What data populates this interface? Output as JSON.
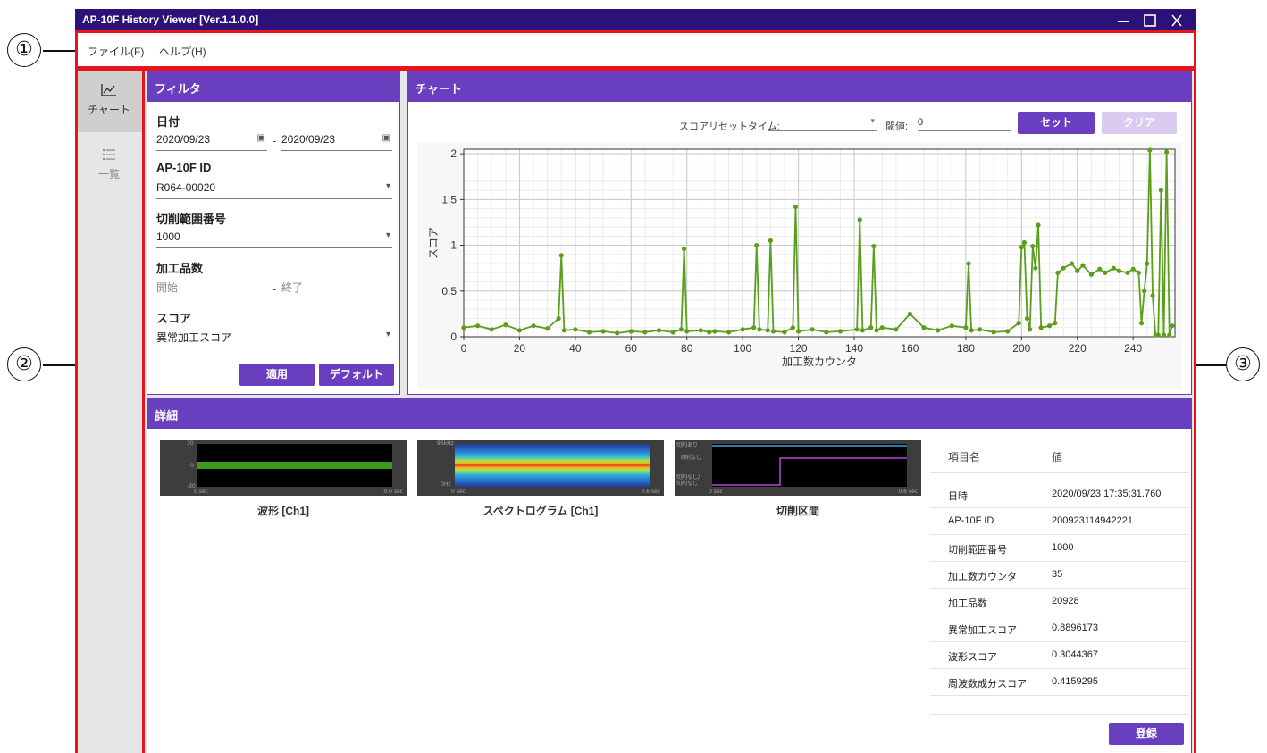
{
  "callouts": {
    "c1": "①",
    "c2": "②",
    "c3": "③"
  },
  "window": {
    "title": "AP-10F History Viewer [Ver.1.1.0.0]"
  },
  "menu": [
    {
      "label": "ファイル(F)"
    },
    {
      "label": "ヘルプ(H)"
    }
  ],
  "nav": [
    {
      "label": "チャート",
      "icon": "chart-line-icon",
      "active": true
    },
    {
      "label": "一覧",
      "icon": "list-icon",
      "active": false
    }
  ],
  "filter": {
    "header": "フィルタ",
    "date_label": "日付",
    "date_from": "2020/09/23",
    "date_to": "2020/09/23",
    "date_sep": "-",
    "id_label": "AP-10F ID",
    "id_value": "R064-00020",
    "range_label": "切削範囲番号",
    "range_value": "1000",
    "count_label": "加工品数",
    "count_start_placeholder": "開始",
    "count_end_placeholder": "終了",
    "count_sep": "-",
    "score_label": "スコア",
    "score_value": "異常加工スコア",
    "apply_button": "適用",
    "default_button": "デフォルト"
  },
  "chart_panel": {
    "header": "チャート",
    "reset_label": "スコアリセットタイム:",
    "reset_value": "",
    "threshold_label": "閾値:",
    "threshold_value": "0",
    "set_button": "セット",
    "clear_button": "クリア"
  },
  "chart_data": {
    "type": "line",
    "xlabel": "加工数カウンタ",
    "ylabel": "スコア",
    "xlim": [
      0,
      255
    ],
    "ylim": [
      0,
      2.05
    ],
    "xticks": [
      0,
      20,
      40,
      60,
      80,
      100,
      120,
      140,
      160,
      180,
      200,
      220,
      240
    ],
    "yticks": [
      0,
      0.5,
      1,
      1.5,
      2
    ],
    "ytick_labels": [
      "0",
      "0.5",
      "1",
      "1.5",
      "2"
    ],
    "grid": true,
    "color": "#5a9e1b",
    "x": [
      0,
      5,
      10,
      15,
      20,
      25,
      30,
      34,
      35,
      36,
      40,
      45,
      50,
      55,
      60,
      65,
      70,
      75,
      78,
      79,
      80,
      85,
      88,
      90,
      95,
      100,
      104,
      105,
      106,
      109,
      110,
      111,
      115,
      118,
      119,
      120,
      125,
      130,
      135,
      141,
      142,
      143,
      146,
      147,
      148,
      150,
      155,
      160,
      165,
      170,
      175,
      180,
      181,
      182,
      185,
      190,
      195,
      199,
      200,
      201,
      202,
      203,
      204,
      205,
      206,
      207,
      210,
      212,
      213,
      215,
      218,
      220,
      222,
      225,
      228,
      230,
      233,
      235,
      238,
      240,
      242,
      243,
      244,
      245,
      246,
      247,
      248,
      249,
      250,
      251,
      252,
      253,
      254
    ],
    "y": [
      0.1,
      0.12,
      0.08,
      0.13,
      0.07,
      0.12,
      0.09,
      0.2,
      0.89,
      0.07,
      0.08,
      0.05,
      0.06,
      0.04,
      0.06,
      0.05,
      0.07,
      0.05,
      0.08,
      0.96,
      0.06,
      0.07,
      0.05,
      0.06,
      0.05,
      0.08,
      0.1,
      1.0,
      0.08,
      0.07,
      1.05,
      0.06,
      0.05,
      0.1,
      1.42,
      0.06,
      0.08,
      0.05,
      0.06,
      0.08,
      1.28,
      0.07,
      0.1,
      0.99,
      0.07,
      0.1,
      0.08,
      0.25,
      0.1,
      0.07,
      0.12,
      0.1,
      0.8,
      0.07,
      0.08,
      0.05,
      0.06,
      0.15,
      0.98,
      1.03,
      0.2,
      0.08,
      0.99,
      0.75,
      1.22,
      0.1,
      0.12,
      0.15,
      0.7,
      0.75,
      0.8,
      0.72,
      0.78,
      0.68,
      0.74,
      0.7,
      0.75,
      0.72,
      0.7,
      0.74,
      0.7,
      0.15,
      0.5,
      0.8,
      2.04,
      0.45,
      0.02,
      0.02,
      1.6,
      0.02,
      2.02,
      0.02,
      0.12
    ]
  },
  "detail": {
    "header": "詳細",
    "thumbs": [
      {
        "caption": "波形 [Ch1]",
        "ytop": "30",
        "ymid": "0",
        "ybot": "-30",
        "xleft": "0 sec",
        "xright": "0.6 sec"
      },
      {
        "caption": "スペクトログラム [Ch1]",
        "ytop": "96kHz",
        "ybot": "0Hz",
        "xleft": "0 sec",
        "xright": "0.6 sec"
      },
      {
        "caption": "切削区間",
        "ytop": "切削あり",
        "ymid": "切削なし",
        "ybot": "切削なし/",
        "ybot2": "切削なし",
        "xleft": "0 sec",
        "xright": "0.6 sec"
      }
    ],
    "props_header": {
      "key": "項目名",
      "value": "値"
    },
    "props": [
      {
        "key": "日時",
        "value": "2020/09/23 17:35:31.760"
      },
      {
        "key": "AP-10F ID",
        "value": "200923114942221"
      },
      {
        "key": "切削範囲番号",
        "value": "1000"
      },
      {
        "key": "加工数カウンタ",
        "value": "35"
      },
      {
        "key": "加工品数",
        "value": "20928"
      },
      {
        "key": "異常加工スコア",
        "value": "0.8896173"
      },
      {
        "key": "波形スコア",
        "value": "0.3044367"
      },
      {
        "key": "周波数成分スコア",
        "value": "0.4159295"
      }
    ],
    "register_button": "登録"
  },
  "colors": {
    "title_bar": "#2b1178",
    "accent": "#6a3fbf",
    "annotation_red": "#e8141b",
    "series": "#5a9e1b"
  }
}
